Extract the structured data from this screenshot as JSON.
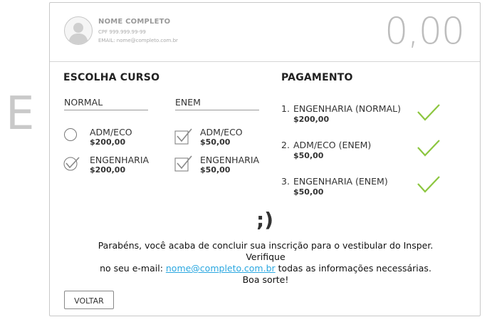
{
  "side_letter": "E",
  "user": {
    "name": "NOME COMPLETO",
    "cpf": "CPF 999.999.99-99",
    "email": "EMAIL: nome@completo.com.br"
  },
  "total": "0,00",
  "course_section": {
    "title": "ESCOLHA CURSO",
    "columns": [
      {
        "heading": "NORMAL",
        "options": [
          {
            "name": "ADM/ECO",
            "price": "$200,00",
            "control": "radio-empty"
          },
          {
            "name": "ENGENHARIA",
            "price": "$200,00",
            "control": "radio-checked"
          }
        ]
      },
      {
        "heading": "ENEM",
        "options": [
          {
            "name": "ADM/ECO",
            "price": "$50,00",
            "control": "checkbox-checked"
          },
          {
            "name": "ENGENHARIA",
            "price": "$50,00",
            "control": "checkbox-checked"
          }
        ]
      }
    ]
  },
  "payment_section": {
    "title": "PAGAMENTO",
    "items": [
      {
        "num": "1.",
        "name": "ENGENHARIA (NORMAL)",
        "price": "$200,00",
        "status_icon": "check-icon"
      },
      {
        "num": "2.",
        "name": "ADM/ECO (ENEM)",
        "price": "$50,00",
        "status_icon": "check-icon"
      },
      {
        "num": "3.",
        "name": "ENGENHARIA (ENEM)",
        "price": "$50,00",
        "status_icon": "check-icon"
      }
    ],
    "check_color": "#8cc63f"
  },
  "emoticon": ";)",
  "message": {
    "line1": "Parabéns, você acaba de concluir sua inscrição para o vestibular do Insper. Verifique",
    "line2_prefix": "no seu e-mail: ",
    "email_link": "nome@completo.com.br",
    "line2_suffix": " todas as informações necessárias.",
    "line3": "Boa sorte!"
  },
  "back_button": "VOLTAR",
  "link_color": "#2aa7e0"
}
